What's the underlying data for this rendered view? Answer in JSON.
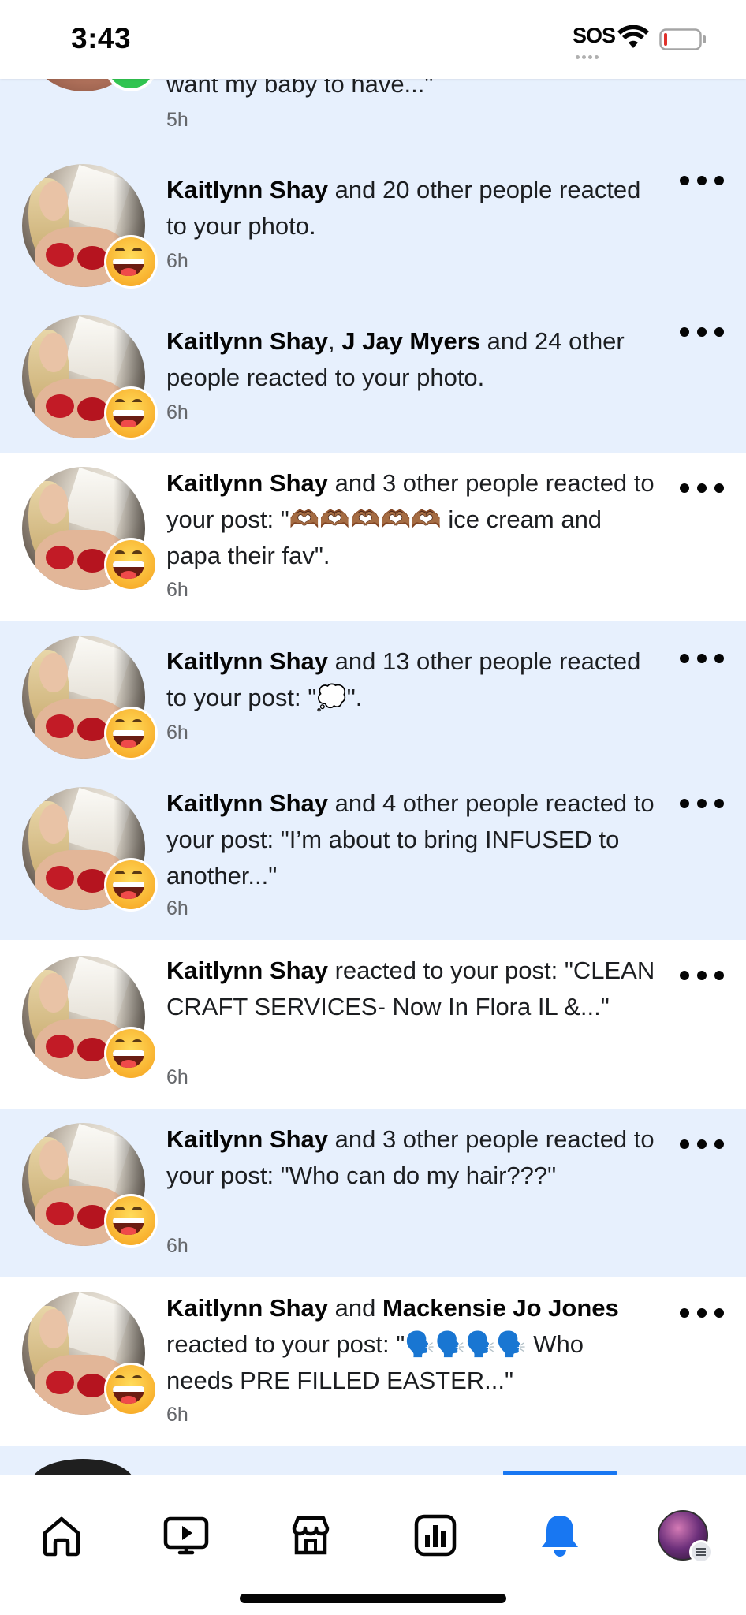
{
  "status_bar": {
    "time": "3:43",
    "sos": "SOS",
    "icons": [
      "wifi-icon",
      "battery-icon"
    ]
  },
  "notifications": [
    {
      "id": 0,
      "partial": true,
      "unread": true,
      "segments": [
        {
          "t": "want my baby to have...\"",
          "b": false
        }
      ],
      "time": "5h",
      "badge": "messenger-badge"
    },
    {
      "id": 1,
      "unread": true,
      "segments": [
        {
          "t": "Kaitlynn Shay",
          "b": true
        },
        {
          "t": " and 20 other people reacted to your photo.",
          "b": false
        }
      ],
      "time": "6h",
      "badge": "haha-reaction"
    },
    {
      "id": 2,
      "unread": true,
      "segments": [
        {
          "t": "Kaitlynn Shay",
          "b": true
        },
        {
          "t": ", ",
          "b": false
        },
        {
          "t": "J Jay Myers",
          "b": true
        },
        {
          "t": " and 24 other people reacted to your photo.",
          "b": false
        }
      ],
      "time": "6h",
      "badge": "haha-reaction"
    },
    {
      "id": 3,
      "unread": false,
      "segments": [
        {
          "t": "Kaitlynn Shay",
          "b": true
        },
        {
          "t": " and 3 other people reacted to your post: \"🫶🏾🫶🏾🫶🏾🫶🏾🫶🏾 ice cream and papa their fav\".",
          "b": false
        }
      ],
      "time": "6h",
      "badge": "haha-reaction"
    },
    {
      "id": 4,
      "unread": true,
      "segments": [
        {
          "t": "Kaitlynn Shay",
          "b": true
        },
        {
          "t": " and 13 other people reacted to your post: \"💭\".",
          "b": false
        }
      ],
      "time": "6h",
      "badge": "haha-reaction"
    },
    {
      "id": 5,
      "unread": true,
      "segments": [
        {
          "t": "Kaitlynn Shay",
          "b": true
        },
        {
          "t": " and 4 other people reacted to your post: \"I’m about to bring INFUSED to another...\"",
          "b": false
        }
      ],
      "time": "6h",
      "badge": "haha-reaction"
    },
    {
      "id": 6,
      "unread": false,
      "segments": [
        {
          "t": "Kaitlynn Shay",
          "b": true
        },
        {
          "t": " reacted to your post: \"CLEAN CRAFT SERVICES- Now In Flora IL &...\"",
          "b": false
        }
      ],
      "time": "6h",
      "badge": "haha-reaction"
    },
    {
      "id": 7,
      "unread": true,
      "segments": [
        {
          "t": "Kaitlynn Shay",
          "b": true
        },
        {
          "t": " and 3 other people reacted to your post: \"Who can do my hair???\"",
          "b": false
        }
      ],
      "time": "6h",
      "badge": "haha-reaction"
    },
    {
      "id": 8,
      "unread": false,
      "segments": [
        {
          "t": "Kaitlynn Shay",
          "b": true
        },
        {
          "t": " and ",
          "b": false
        },
        {
          "t": "Mackensie Jo Jones",
          "b": true
        },
        {
          "t": " reacted to your post: \"🗣️🗣️🗣️🗣️ Who needs PRE FILLED EASTER...\"",
          "b": false
        }
      ],
      "time": "6h",
      "badge": "haha-reaction"
    }
  ],
  "bottom_nav": {
    "items": [
      "home-icon",
      "video-icon",
      "marketplace-icon",
      "dashboard-icon",
      "notifications-bell-icon",
      "profile-avatar"
    ],
    "active": "notifications-bell-icon",
    "accent": "#1877f2"
  },
  "colors": {
    "unread_bg": "#e7f0fd",
    "read_bg": "#ffffff",
    "secondary_text": "#65676b"
  }
}
